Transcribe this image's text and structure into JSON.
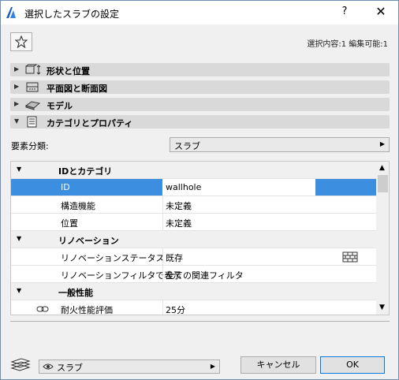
{
  "window": {
    "title": "選択したスラブの設定",
    "help_label": "?",
    "close_label": "✕"
  },
  "status": "選択内容:1 編集可能:1",
  "sections": [
    {
      "label": "形状と位置",
      "icon": "geometry-icon",
      "expanded": false
    },
    {
      "label": "平面図と断面図",
      "icon": "floorplan-icon",
      "expanded": false
    },
    {
      "label": "モデル",
      "icon": "model-icon",
      "expanded": false
    },
    {
      "label": "カテゴリとプロパティ",
      "icon": "properties-icon",
      "expanded": true
    }
  ],
  "classification": {
    "label": "要素分類:",
    "value": "スラブ"
  },
  "groups": [
    {
      "name": "IDとカテゴリ"
    },
    {
      "name": "リノベーション"
    },
    {
      "name": "一般性能"
    }
  ],
  "props": {
    "id": {
      "name": "ID",
      "value": "wallhole"
    },
    "structural": {
      "name": "構造機能",
      "value": "未定義"
    },
    "position": {
      "name": "位置",
      "value": "未定義"
    },
    "reno_status": {
      "name": "リノベーションステータス",
      "value": "既存"
    },
    "reno_filter": {
      "name": "リノベーションフィルタで表示",
      "value": "全ての関連フィルタ"
    },
    "fire": {
      "name": "耐火性能評価",
      "value": "25分"
    }
  },
  "footer": {
    "layer_value": "スラブ",
    "cancel_label": "キャンセル",
    "ok_label": "OK"
  },
  "colors": {
    "selection": "#3b8ee0",
    "section_header": "#d9d9d9"
  }
}
